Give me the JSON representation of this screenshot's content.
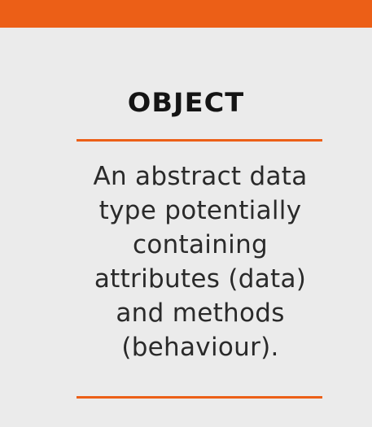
{
  "slide": {
    "title": "OBJECT",
    "definition_lines": [
      "An abstract data",
      "type potentially",
      "containing",
      "attributes (data)",
      "and methods",
      "(behaviour)."
    ]
  },
  "colors": {
    "accent": "#ec5f17",
    "background": "#ebebeb",
    "title_text": "#141414",
    "body_text": "#2a2a2a"
  }
}
